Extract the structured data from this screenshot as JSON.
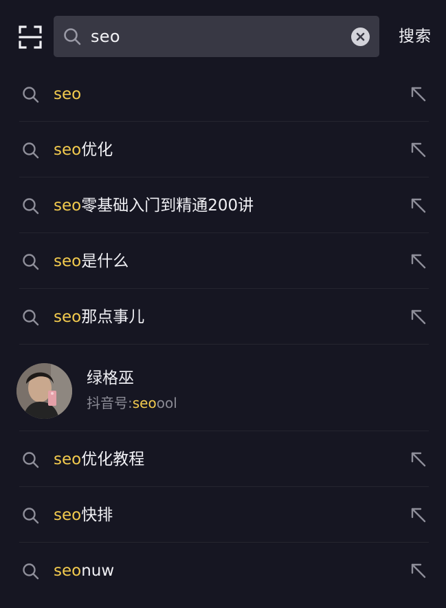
{
  "header": {
    "scan_icon": "scan-icon",
    "search": {
      "query": "seo",
      "search_icon": "search-icon",
      "clear_icon": "clear-icon"
    },
    "submit_label": "搜索"
  },
  "suggestions": [
    {
      "highlight": "seo",
      "rest": ""
    },
    {
      "highlight": "seo",
      "rest": "优化"
    },
    {
      "highlight": "seo",
      "rest": "零基础入门到精通200讲"
    },
    {
      "highlight": "seo",
      "rest": "是什么"
    },
    {
      "highlight": "seo",
      "rest": "那点事儿"
    }
  ],
  "user": {
    "name": "绿格巫",
    "id_label": "抖音号:",
    "id_highlight": "seo",
    "id_rest": "ool"
  },
  "suggestions_more": [
    {
      "highlight": "seo",
      "rest": "优化教程"
    },
    {
      "highlight": "seo",
      "rest": "快排"
    },
    {
      "highlight": "seo",
      "rest": "nuw"
    }
  ],
  "colors": {
    "background": "#161622",
    "search_box": "#383844",
    "highlight": "#F3CB4E",
    "secondary_text": "#8B8B95"
  },
  "icons": {
    "row_leading": "search-icon",
    "row_trailing": "fill-in-arrow-icon"
  }
}
